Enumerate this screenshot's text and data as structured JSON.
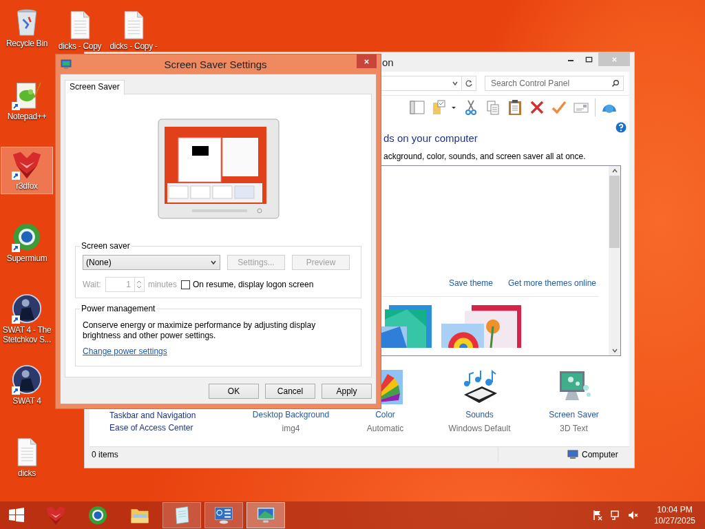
{
  "desktop_icons": [
    {
      "label": "Recycle Bin",
      "kind": "recycle",
      "shortcut": false,
      "selected": false
    },
    {
      "label": "dicks - Copy",
      "kind": "file",
      "shortcut": false,
      "selected": false
    },
    {
      "label": "dicks - Copy -",
      "kind": "file",
      "shortcut": false,
      "selected": false
    },
    {
      "label": "Notepad++",
      "kind": "notepad",
      "shortcut": true,
      "selected": false
    },
    {
      "label": "r3dfox",
      "kind": "r3dfox",
      "shortcut": true,
      "selected": true
    },
    {
      "label": "Supermium",
      "kind": "supermium",
      "shortcut": true,
      "selected": false
    },
    {
      "label": "SWAT 4 - The Stetchkov S...",
      "kind": "game",
      "shortcut": true,
      "selected": false
    },
    {
      "label": "SWAT 4",
      "kind": "game",
      "shortcut": true,
      "selected": false
    },
    {
      "label": "dicks",
      "kind": "file",
      "shortcut": false,
      "selected": false
    }
  ],
  "control_panel": {
    "title": "on",
    "search": {
      "placeholder": "Search Control Panel"
    },
    "heading": "ds on your computer",
    "description": "ackground, color, sounds, and screen saver all at once.",
    "links": [
      "Save theme",
      "Get more themes online"
    ],
    "see_also": [
      "Taskbar and Navigation",
      "Ease of Access Center"
    ],
    "settings": [
      {
        "kind": "background",
        "label": "Desktop Background",
        "value": "img4"
      },
      {
        "kind": "color",
        "label": "Color",
        "value": "Automatic"
      },
      {
        "kind": "sounds",
        "label": "Sounds",
        "value": "Windows Default"
      },
      {
        "kind": "screensaver",
        "label": "Screen Saver",
        "value": "3D Text"
      }
    ],
    "status_bar": {
      "items": "0 items",
      "location": "Computer"
    }
  },
  "dialog": {
    "title": "Screen Saver Settings",
    "tabs": [
      {
        "label": "Screen Saver",
        "selected": true
      }
    ],
    "screen_saver": {
      "group": "Screen saver",
      "selection": "(None)",
      "buttons": [
        {
          "label": "Settings...",
          "disabled": true
        },
        {
          "label": "Preview",
          "disabled": true
        }
      ],
      "wait_label": "Wait:",
      "wait_value": "1",
      "wait_unit": "minutes",
      "wait_disabled": true,
      "logon": {
        "label": "On resume, display logon screen",
        "checked": false
      }
    },
    "power": {
      "group": "Power management",
      "text": "Conserve energy or maximize performance by adjusting display brightness and other power settings.",
      "link": "Change power settings"
    },
    "buttons": [
      "OK",
      "Cancel",
      "Apply"
    ]
  },
  "taskbar": {
    "apps": [
      {
        "kind": "r3dfox",
        "open": false,
        "selected": false
      },
      {
        "kind": "supermium",
        "open": false,
        "selected": false
      },
      {
        "kind": "explorer",
        "open": false,
        "selected": false
      },
      {
        "kind": "notepad",
        "open": true,
        "selected": false
      },
      {
        "kind": "control",
        "open": true,
        "selected": false
      },
      {
        "kind": "display",
        "open": true,
        "selected": true
      }
    ],
    "muted": true,
    "time": "10:04 PM",
    "date": "10/27/2025"
  }
}
